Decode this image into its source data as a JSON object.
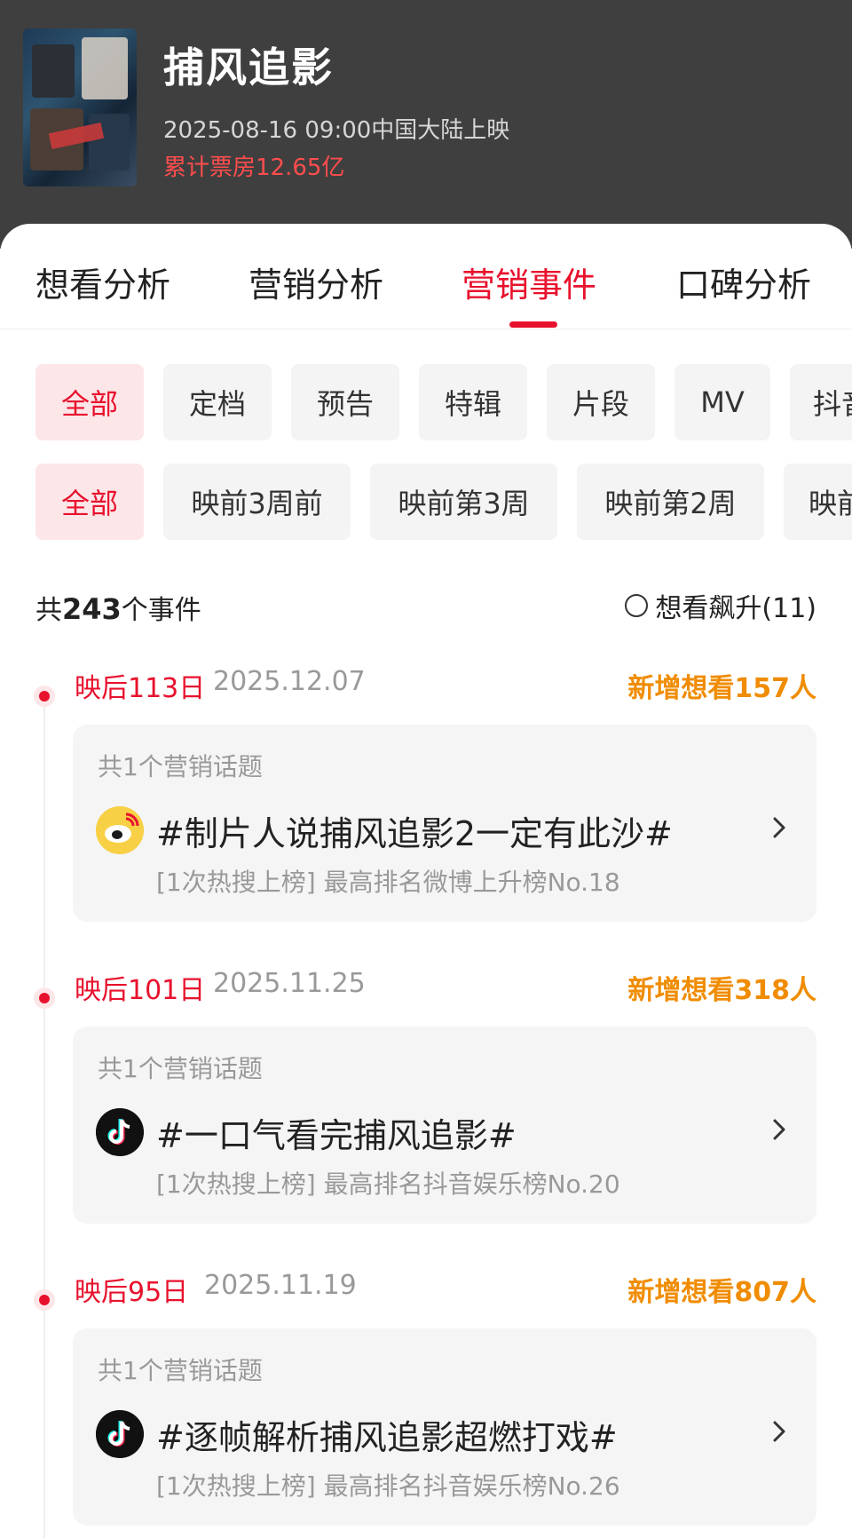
{
  "movie": {
    "title": "捕风追影",
    "release_info": "2025-08-16 09:00中国大陆上映",
    "boxoffice": "累计票房12.65亿"
  },
  "tabs": [
    {
      "label": "想看分析",
      "active": false
    },
    {
      "label": "营销分析",
      "active": false
    },
    {
      "label": "营销事件",
      "active": true
    },
    {
      "label": "口碑分析",
      "active": false
    }
  ],
  "type_filters": [
    "全部",
    "定档",
    "预告",
    "特辑",
    "片段",
    "MV",
    "抖音"
  ],
  "period_filters": [
    "全部",
    "映前3周前",
    "映前第3周",
    "映前第2周",
    "映前"
  ],
  "summary": {
    "prefix": "共",
    "count": "243",
    "suffix": "个事件",
    "filter_label": "想看飙升(11)"
  },
  "events": [
    {
      "day": "映后113日",
      "date": "2025.12.07",
      "want": "新增想看157人",
      "topic_count": "共1个营销话题",
      "icon": "weibo-icon",
      "topic": "#制片人说捕风追影2一定有此沙#",
      "detail": "[1次热搜上榜] 最高排名微博上升榜No.18"
    },
    {
      "day": "映后101日",
      "date": "2025.11.25",
      "want": "新增想看318人",
      "topic_count": "共1个营销话题",
      "icon": "douyin-icon",
      "topic": "#一口气看完捕风追影#",
      "detail": "[1次热搜上榜] 最高排名抖音娱乐榜No.20"
    },
    {
      "day": "映后95日",
      "date": "2025.11.19",
      "want": "新增想看807人",
      "topic_count": "共1个营销话题",
      "icon": "douyin-icon",
      "topic": "#逐帧解析捕风追影超燃打戏#",
      "detail": "[1次热搜上榜] 最高排名抖音娱乐榜No.26"
    }
  ],
  "colors": {
    "accent": "#e8112d",
    "orange": "#f08c00",
    "header_bg": "#3f3f3f"
  }
}
